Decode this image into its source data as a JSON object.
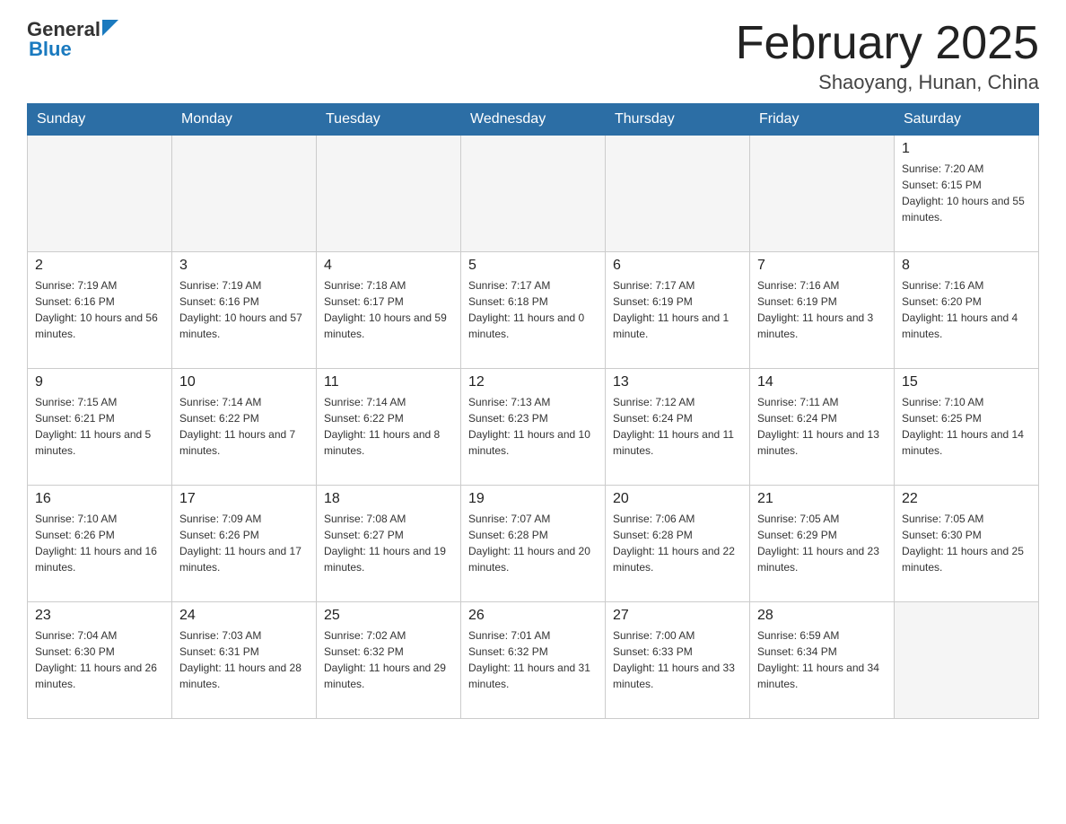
{
  "header": {
    "logo_general": "General",
    "logo_blue": "Blue",
    "title": "February 2025",
    "subtitle": "Shaoyang, Hunan, China"
  },
  "weekdays": [
    "Sunday",
    "Monday",
    "Tuesday",
    "Wednesday",
    "Thursday",
    "Friday",
    "Saturday"
  ],
  "weeks": [
    [
      {
        "num": "",
        "sunrise": "",
        "sunset": "",
        "daylight": ""
      },
      {
        "num": "",
        "sunrise": "",
        "sunset": "",
        "daylight": ""
      },
      {
        "num": "",
        "sunrise": "",
        "sunset": "",
        "daylight": ""
      },
      {
        "num": "",
        "sunrise": "",
        "sunset": "",
        "daylight": ""
      },
      {
        "num": "",
        "sunrise": "",
        "sunset": "",
        "daylight": ""
      },
      {
        "num": "",
        "sunrise": "",
        "sunset": "",
        "daylight": ""
      },
      {
        "num": "1",
        "sunrise": "Sunrise: 7:20 AM",
        "sunset": "Sunset: 6:15 PM",
        "daylight": "Daylight: 10 hours and 55 minutes."
      }
    ],
    [
      {
        "num": "2",
        "sunrise": "Sunrise: 7:19 AM",
        "sunset": "Sunset: 6:16 PM",
        "daylight": "Daylight: 10 hours and 56 minutes."
      },
      {
        "num": "3",
        "sunrise": "Sunrise: 7:19 AM",
        "sunset": "Sunset: 6:16 PM",
        "daylight": "Daylight: 10 hours and 57 minutes."
      },
      {
        "num": "4",
        "sunrise": "Sunrise: 7:18 AM",
        "sunset": "Sunset: 6:17 PM",
        "daylight": "Daylight: 10 hours and 59 minutes."
      },
      {
        "num": "5",
        "sunrise": "Sunrise: 7:17 AM",
        "sunset": "Sunset: 6:18 PM",
        "daylight": "Daylight: 11 hours and 0 minutes."
      },
      {
        "num": "6",
        "sunrise": "Sunrise: 7:17 AM",
        "sunset": "Sunset: 6:19 PM",
        "daylight": "Daylight: 11 hours and 1 minute."
      },
      {
        "num": "7",
        "sunrise": "Sunrise: 7:16 AM",
        "sunset": "Sunset: 6:19 PM",
        "daylight": "Daylight: 11 hours and 3 minutes."
      },
      {
        "num": "8",
        "sunrise": "Sunrise: 7:16 AM",
        "sunset": "Sunset: 6:20 PM",
        "daylight": "Daylight: 11 hours and 4 minutes."
      }
    ],
    [
      {
        "num": "9",
        "sunrise": "Sunrise: 7:15 AM",
        "sunset": "Sunset: 6:21 PM",
        "daylight": "Daylight: 11 hours and 5 minutes."
      },
      {
        "num": "10",
        "sunrise": "Sunrise: 7:14 AM",
        "sunset": "Sunset: 6:22 PM",
        "daylight": "Daylight: 11 hours and 7 minutes."
      },
      {
        "num": "11",
        "sunrise": "Sunrise: 7:14 AM",
        "sunset": "Sunset: 6:22 PM",
        "daylight": "Daylight: 11 hours and 8 minutes."
      },
      {
        "num": "12",
        "sunrise": "Sunrise: 7:13 AM",
        "sunset": "Sunset: 6:23 PM",
        "daylight": "Daylight: 11 hours and 10 minutes."
      },
      {
        "num": "13",
        "sunrise": "Sunrise: 7:12 AM",
        "sunset": "Sunset: 6:24 PM",
        "daylight": "Daylight: 11 hours and 11 minutes."
      },
      {
        "num": "14",
        "sunrise": "Sunrise: 7:11 AM",
        "sunset": "Sunset: 6:24 PM",
        "daylight": "Daylight: 11 hours and 13 minutes."
      },
      {
        "num": "15",
        "sunrise": "Sunrise: 7:10 AM",
        "sunset": "Sunset: 6:25 PM",
        "daylight": "Daylight: 11 hours and 14 minutes."
      }
    ],
    [
      {
        "num": "16",
        "sunrise": "Sunrise: 7:10 AM",
        "sunset": "Sunset: 6:26 PM",
        "daylight": "Daylight: 11 hours and 16 minutes."
      },
      {
        "num": "17",
        "sunrise": "Sunrise: 7:09 AM",
        "sunset": "Sunset: 6:26 PM",
        "daylight": "Daylight: 11 hours and 17 minutes."
      },
      {
        "num": "18",
        "sunrise": "Sunrise: 7:08 AM",
        "sunset": "Sunset: 6:27 PM",
        "daylight": "Daylight: 11 hours and 19 minutes."
      },
      {
        "num": "19",
        "sunrise": "Sunrise: 7:07 AM",
        "sunset": "Sunset: 6:28 PM",
        "daylight": "Daylight: 11 hours and 20 minutes."
      },
      {
        "num": "20",
        "sunrise": "Sunrise: 7:06 AM",
        "sunset": "Sunset: 6:28 PM",
        "daylight": "Daylight: 11 hours and 22 minutes."
      },
      {
        "num": "21",
        "sunrise": "Sunrise: 7:05 AM",
        "sunset": "Sunset: 6:29 PM",
        "daylight": "Daylight: 11 hours and 23 minutes."
      },
      {
        "num": "22",
        "sunrise": "Sunrise: 7:05 AM",
        "sunset": "Sunset: 6:30 PM",
        "daylight": "Daylight: 11 hours and 25 minutes."
      }
    ],
    [
      {
        "num": "23",
        "sunrise": "Sunrise: 7:04 AM",
        "sunset": "Sunset: 6:30 PM",
        "daylight": "Daylight: 11 hours and 26 minutes."
      },
      {
        "num": "24",
        "sunrise": "Sunrise: 7:03 AM",
        "sunset": "Sunset: 6:31 PM",
        "daylight": "Daylight: 11 hours and 28 minutes."
      },
      {
        "num": "25",
        "sunrise": "Sunrise: 7:02 AM",
        "sunset": "Sunset: 6:32 PM",
        "daylight": "Daylight: 11 hours and 29 minutes."
      },
      {
        "num": "26",
        "sunrise": "Sunrise: 7:01 AM",
        "sunset": "Sunset: 6:32 PM",
        "daylight": "Daylight: 11 hours and 31 minutes."
      },
      {
        "num": "27",
        "sunrise": "Sunrise: 7:00 AM",
        "sunset": "Sunset: 6:33 PM",
        "daylight": "Daylight: 11 hours and 33 minutes."
      },
      {
        "num": "28",
        "sunrise": "Sunrise: 6:59 AM",
        "sunset": "Sunset: 6:34 PM",
        "daylight": "Daylight: 11 hours and 34 minutes."
      },
      {
        "num": "",
        "sunrise": "",
        "sunset": "",
        "daylight": ""
      }
    ]
  ]
}
